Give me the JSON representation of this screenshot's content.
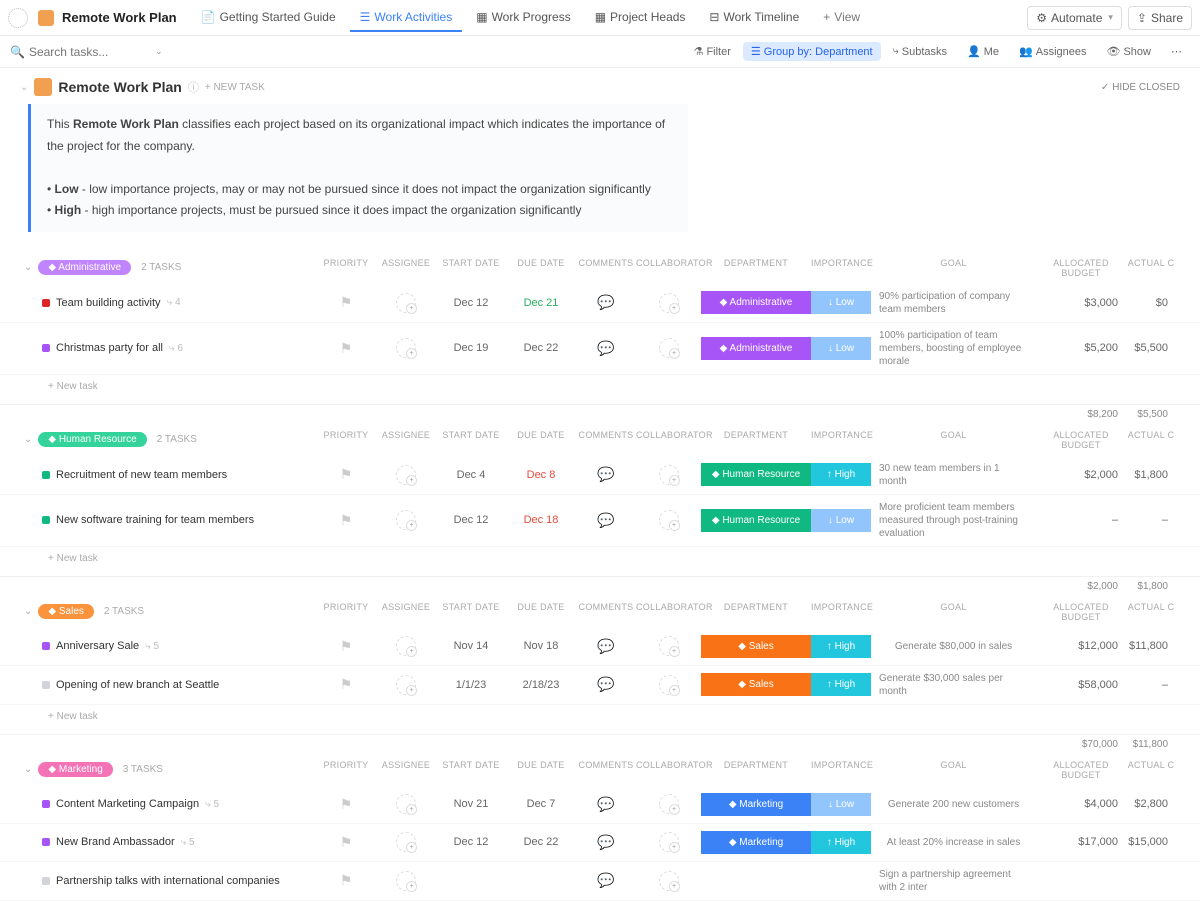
{
  "space": {
    "title": "Remote Work Plan"
  },
  "tabs": [
    {
      "label": "Getting Started Guide"
    },
    {
      "label": "Work Activities"
    },
    {
      "label": "Work Progress"
    },
    {
      "label": "Project Heads"
    },
    {
      "label": "Work Timeline"
    }
  ],
  "tab_add": "View",
  "top_buttons": {
    "automate": "Automate",
    "share": "Share"
  },
  "search_placeholder": "Search tasks...",
  "toolbar": {
    "filter": "Filter",
    "groupby": "Group by: Department",
    "subtasks": "Subtasks",
    "me": "Me",
    "assignees": "Assignees",
    "show": "Show"
  },
  "page": {
    "title": "Remote Work Plan",
    "new_task": "+ NEW TASK",
    "hide_closed": "HIDE CLOSED"
  },
  "desc": {
    "line1a": "This ",
    "line1b": "Remote Work Plan",
    "line1c": " classifies each project based on its organizational impact which indicates the importance of the project for the company.",
    "line2a": "Low",
    "line2b": " - low importance projects, may or may not be pursued since it does not impact the organization significantly",
    "line3a": "High",
    "line3b": " - high importance projects, must be pursued since it does impact the organization significantly"
  },
  "cols": {
    "priority": "PRIORITY",
    "assignee": "ASSIGNEE",
    "start": "START DATE",
    "due": "DUE DATE",
    "comments": "COMMENTS",
    "collab": "COLLABORATOR",
    "dept": "DEPARTMENT",
    "importance": "IMPORTANCE",
    "goal": "GOAL",
    "budget": "ALLOCATED BUDGET",
    "actual": "ACTUAL C"
  },
  "new_task_label": "+ New task",
  "groups": [
    {
      "name": "Administrative",
      "count": "2 TASKS",
      "pill_class": "pill-admin",
      "rows": [
        {
          "dot": "dot-red",
          "name": "Team building activity",
          "sub": "4",
          "start": "Dec 12",
          "due": "Dec 21",
          "due_class": "date-green",
          "dept": "Administrative",
          "dept_class": "c-admin",
          "imp": "Low",
          "imp_class": "c-low",
          "goal": "90% participation of company team members",
          "budget": "$3,000",
          "actual": "$0"
        },
        {
          "dot": "dot-purple",
          "name": "Christmas party for all",
          "sub": "6",
          "start": "Dec 19",
          "due": "Dec 22",
          "due_class": "",
          "dept": "Administrative",
          "dept_class": "c-admin",
          "imp": "Low",
          "imp_class": "c-low",
          "goal": "100% participation of team members, boosting of employee morale",
          "budget": "$5,200",
          "actual": "$5,500"
        }
      ],
      "sum_budget": "$8,200",
      "sum_actual": "$5,500"
    },
    {
      "name": "Human Resource",
      "count": "2 TASKS",
      "pill_class": "pill-hr",
      "rows": [
        {
          "dot": "dot-green",
          "name": "Recruitment of new team members",
          "sub": "",
          "start": "Dec 4",
          "due": "Dec 8",
          "due_class": "date-red",
          "dept": "Human Resource",
          "dept_class": "c-hr",
          "imp": "High",
          "imp_class": "c-high",
          "goal": "30 new team members in 1 month",
          "budget": "$2,000",
          "actual": "$1,800"
        },
        {
          "dot": "dot-green",
          "name": "New software training for team members",
          "sub": "",
          "start": "Dec 12",
          "due": "Dec 18",
          "due_class": "date-red",
          "dept": "Human Resource",
          "dept_class": "c-hr",
          "imp": "Low",
          "imp_class": "c-low",
          "goal": "More proficient team members measured through post-training evaluation",
          "budget": "–",
          "actual": "–"
        }
      ],
      "sum_budget": "$2,000",
      "sum_actual": "$1,800"
    },
    {
      "name": "Sales",
      "count": "2 TASKS",
      "pill_class": "pill-sales",
      "rows": [
        {
          "dot": "dot-purple",
          "name": "Anniversary Sale",
          "sub": "5",
          "start": "Nov 14",
          "due": "Nov 18",
          "due_class": "",
          "dept": "Sales",
          "dept_class": "c-sales",
          "imp": "High",
          "imp_class": "c-high",
          "goal": "Generate $80,000 in sales",
          "budget": "$12,000",
          "actual": "$11,800"
        },
        {
          "dot": "dot-gray",
          "name": "Opening of new branch at Seattle",
          "sub": "",
          "start": "1/1/23",
          "due": "2/18/23",
          "due_class": "",
          "dept": "Sales",
          "dept_class": "c-sales",
          "imp": "High",
          "imp_class": "c-high",
          "goal": "Generate $30,000 sales per month",
          "budget": "$58,000",
          "actual": "–"
        }
      ],
      "sum_budget": "$70,000",
      "sum_actual": "$11,800"
    },
    {
      "name": "Marketing",
      "count": "3 TASKS",
      "pill_class": "pill-mkt",
      "rows": [
        {
          "dot": "dot-purple",
          "name": "Content Marketing Campaign",
          "sub": "5",
          "start": "Nov 21",
          "due": "Dec 7",
          "due_class": "",
          "dept": "Marketing",
          "dept_class": "c-mkt",
          "imp": "Low",
          "imp_class": "c-low",
          "goal": "Generate 200 new customers",
          "budget": "$4,000",
          "actual": "$2,800"
        },
        {
          "dot": "dot-purple",
          "name": "New Brand Ambassador",
          "sub": "5",
          "start": "Dec 12",
          "due": "Dec 22",
          "due_class": "",
          "dept": "Marketing",
          "dept_class": "c-mkt",
          "imp": "High",
          "imp_class": "c-high",
          "goal": "At least 20% increase in sales",
          "budget": "$17,000",
          "actual": "$15,000"
        },
        {
          "dot": "dot-gray",
          "name": "Partnership talks with international companies",
          "sub": "",
          "start": "",
          "due": "",
          "due_class": "",
          "dept": "",
          "dept_class": "",
          "imp": "",
          "imp_class": "",
          "goal": "Sign a partnership agreement with 2 inter",
          "budget": "",
          "actual": ""
        }
      ],
      "sum_budget": "",
      "sum_actual": ""
    }
  ]
}
